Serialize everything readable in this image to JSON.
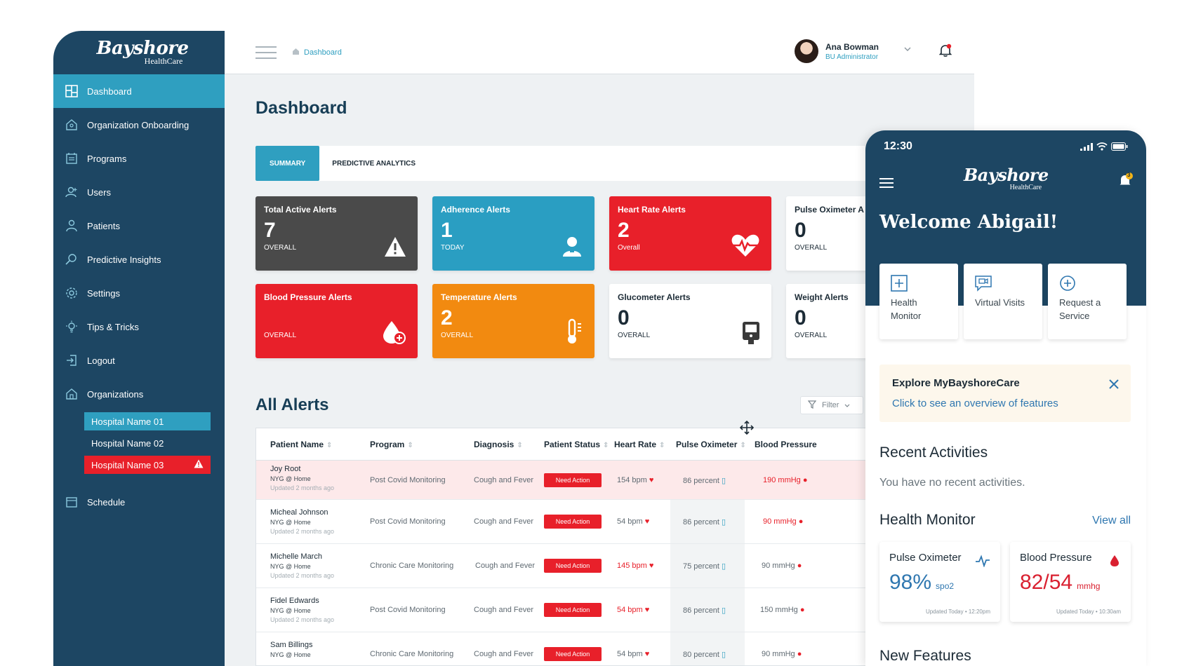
{
  "brand": {
    "name": "Bayshore",
    "sub": "HealthCare"
  },
  "sidebar": {
    "items": [
      {
        "label": "Dashboard",
        "icon": "dashboard-grid-icon"
      },
      {
        "label": "Organization Onboarding",
        "icon": "home-icon"
      },
      {
        "label": "Programs",
        "icon": "calendar-list-icon"
      },
      {
        "label": "Users",
        "icon": "user-add-icon"
      },
      {
        "label": "Patients",
        "icon": "person-icon"
      },
      {
        "label": "Predictive Insights",
        "icon": "search-insight-icon"
      },
      {
        "label": "Settings",
        "icon": "gear-icon"
      },
      {
        "label": "Tips & Tricks",
        "icon": "bulb-icon"
      },
      {
        "label": "Logout",
        "icon": "logout-icon"
      },
      {
        "label": "Organizations",
        "icon": "building-icon"
      }
    ],
    "organizations": [
      "Hospital Name 01",
      "Hospital Name 02",
      "Hospital Name 03"
    ],
    "schedule": "Schedule"
  },
  "header": {
    "breadcrumb": "Dashboard",
    "user_name": "Ana Bowman",
    "user_role": "BU Administrator"
  },
  "page_title": "Dashboard",
  "tabs": [
    "SUMMARY",
    "PREDICTIVE ANALYTICS"
  ],
  "cards": [
    {
      "title": "Total Active Alerts",
      "value": "7",
      "sub": "OVERALL",
      "color": "#4a4a4a"
    },
    {
      "title": "Adherence Alerts",
      "value": "1",
      "sub": "TODAY",
      "color": "#2a9ec2"
    },
    {
      "title": "Heart Rate Alerts",
      "value": "2",
      "sub": "Overall",
      "color": "#e8202a"
    },
    {
      "title": "Pulse Oximeter A",
      "value": "0",
      "sub": "OVERALL",
      "color": "#ffffff"
    },
    {
      "title": "Blood Pressure Alerts",
      "value": "",
      "sub": "OVERALL",
      "color": "#e8202a"
    },
    {
      "title": "Temperature Alerts",
      "value": "2",
      "sub": "OVERALL",
      "color": "#f28a10"
    },
    {
      "title": "Glucometer Alerts",
      "value": "0",
      "sub": "OVERALL",
      "color": "#ffffff"
    },
    {
      "title": "Weight Alerts",
      "value": "0",
      "sub": "OVERALL",
      "color": "#ffffff"
    }
  ],
  "all_alerts": {
    "title": "All Alerts",
    "filter": "Filter"
  },
  "table": {
    "headers": [
      "Patient Name",
      "Program",
      "Diagnosis",
      "Patient Status",
      "Heart Rate",
      "Pulse Oximeter",
      "Blood Pressure"
    ],
    "rows": [
      {
        "name": "Joy Root",
        "loc": "NYG @ Home",
        "updated": "Updated 2 months ago",
        "program": "Post Covid Monitoring",
        "diagnosis": "Cough and Fever",
        "status": "Need Action",
        "hr": "154 bpm",
        "ox": "86 percent",
        "bp": "190 mmHg"
      },
      {
        "name": "Micheal Johnson",
        "loc": "NYG @ Home",
        "updated": "Updated 2 months ago",
        "program": "Post Covid Monitoring",
        "diagnosis": "Cough and Fever",
        "status": "Need Action",
        "hr": "54 bpm",
        "ox": "86 percent",
        "bp": "90 mmHg"
      },
      {
        "name": "Michelle March",
        "loc": "NYG @ Home",
        "updated": "Updated 2 months ago",
        "program": "Chronic Care Monitoring",
        "diagnosis": "Cough and Fever",
        "status": "Need Action",
        "hr": "145 bpm",
        "ox": "75 percent",
        "bp": "90 mmHg"
      },
      {
        "name": "Fidel Edwards",
        "loc": "NYG @ Home",
        "updated": "Updated 2 months ago",
        "program": "Post Covid Monitoring",
        "diagnosis": "Cough and Fever",
        "status": "Need Action",
        "hr": "54 bpm",
        "ox": "86 percent",
        "bp": "150 mmHg"
      },
      {
        "name": "Sam Billings",
        "loc": "NYG @ Home",
        "updated": "",
        "program": "Chronic Care Monitoring",
        "diagnosis": "Cough and Fever",
        "status": "Need Action",
        "hr": "54 bpm",
        "ox": "80 percent",
        "bp": "90 mmHg"
      }
    ]
  },
  "phone": {
    "time": "12:30",
    "notification_count": "3",
    "welcome": "Welcome Abigail!",
    "services": [
      "Health Monitor",
      "Virtual Visits",
      "Request a Service"
    ],
    "explore_title": "Explore MyBayshoreCare",
    "explore_link": "Click to see an overview of features",
    "recent_title": "Recent Activities",
    "recent_empty": "You have no recent activities.",
    "health_title": "Health Monitor",
    "view_all": "View all",
    "monitor": [
      {
        "title": "Pulse Oximeter",
        "value": "98%",
        "unit": "spo2",
        "updated": "Updated Today • 12:20pm",
        "color": "#2f77b0"
      },
      {
        "title": "Blood Pressure",
        "value": "82/54",
        "unit": "mmhg",
        "updated": "Updated Today • 10:30am",
        "color": "#d92030"
      }
    ],
    "new_features": "New Features"
  }
}
